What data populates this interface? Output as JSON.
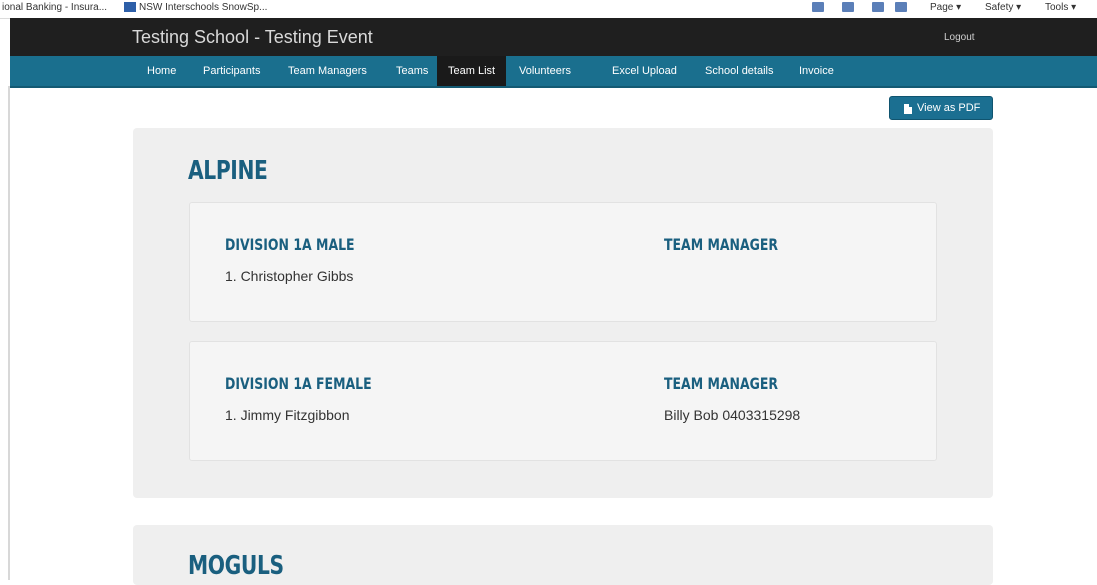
{
  "browser": {
    "favorites": [
      "ional Banking - Insura...",
      "NSW Interschools SnowSp..."
    ],
    "toolbar": [
      "Page ▾",
      "Safety ▾",
      "Tools ▾"
    ]
  },
  "header": {
    "title": "Testing School - Testing Event",
    "logout": "Logout"
  },
  "nav": {
    "items": [
      "Home",
      "Participants",
      "Team Managers",
      "Teams",
      "Team List",
      "Volunteers",
      "Excel Upload",
      "School details",
      "Invoice"
    ],
    "active": "Team List"
  },
  "actions": {
    "view_pdf": "View as PDF"
  },
  "sections": [
    {
      "title": "ALPINE",
      "teams": [
        {
          "division": "DIVISION 1A MALE",
          "participants": [
            "1. Christopher Gibbs"
          ],
          "manager_heading": "TEAM MANAGER",
          "manager": ""
        },
        {
          "division": "DIVISION 1A FEMALE",
          "participants": [
            "1. Jimmy Fitzgibbon"
          ],
          "manager_heading": "TEAM MANAGER",
          "manager": "Billy Bob 0403315298"
        }
      ]
    },
    {
      "title": "MOGULS",
      "teams": []
    }
  ],
  "colors": {
    "topbar": "#1f1f1f",
    "nav": "#1a6f8e",
    "heading": "#1a5f7f",
    "panel": "#efefef"
  }
}
